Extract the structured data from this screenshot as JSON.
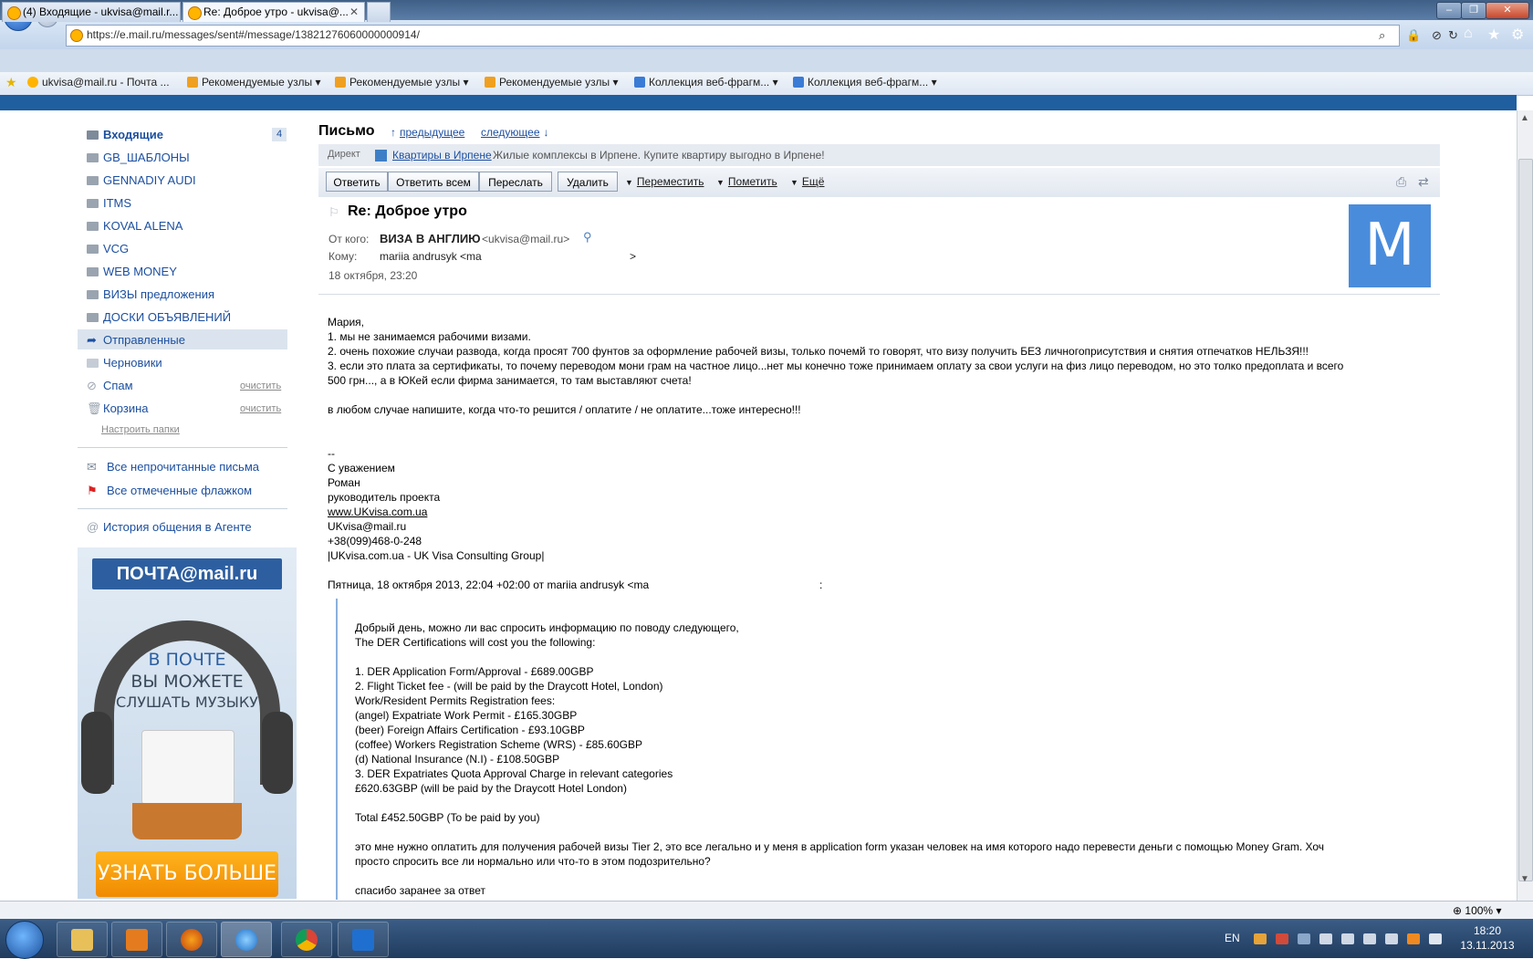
{
  "browser": {
    "url": "https://e.mail.ru/messages/sent#/message/13821276060000000914/",
    "tabs": [
      {
        "label": "(4) Входящие - ukvisa@mail.r..."
      },
      {
        "label": "Re: Доброе утро - ukvisa@..."
      }
    ],
    "favorites": [
      "ukvisa@mail.ru - Почта ...",
      "Рекомендуемые узлы",
      "Рекомендуемые узлы",
      "Рекомендуемые узлы",
      "Коллекция веб-фрагм...",
      "Коллекция веб-фрагм..."
    ],
    "zoom": "100%"
  },
  "sidebar": {
    "inbox": {
      "label": "Входящие",
      "count": "4"
    },
    "folders": [
      "GB_ШАБЛОНЫ",
      "GENNADIY AUDI",
      "ITMS",
      "KOVAL ALENA",
      "VCG",
      "WEB MONEY",
      "ВИЗЫ предложения",
      "ДОСКИ ОБЪЯВЛЕНИЙ"
    ],
    "sent": "Отправленные",
    "drafts": "Черновики",
    "spam": {
      "label": "Спам",
      "action": "очистить"
    },
    "trash": {
      "label": "Корзина",
      "action": "очистить"
    },
    "configure": "Настроить папки",
    "unread": "Все непрочитанные письма",
    "flagged": "Все отмеченные флажком",
    "agent": "История общения в Агенте",
    "ad": {
      "logo": "ПОЧТА@mail.ru",
      "line1": "В ПОЧТЕ",
      "line2": "ВЫ МОЖЕТЕ",
      "line3": "СЛУШАТЬ МУЗЫКУ",
      "button": "УЗНАТЬ БОЛЬШЕ"
    }
  },
  "message": {
    "section": "Письмо",
    "prev": "предыдущее",
    "next": "следующее",
    "direct": {
      "label": "Директ",
      "link": "Квартиры в Ирпене",
      "text": "Жилые комплексы в Ирпене. Купите квартиру выгодно в Ирпене!"
    },
    "actions": {
      "reply": "Ответить",
      "reply_all": "Ответить всем",
      "forward": "Переслать",
      "delete": "Удалить",
      "move": "Переместить",
      "mark": "Пометить",
      "more": "Ещё"
    },
    "subject": "Re: Доброе утро",
    "from_label": "От кого:",
    "from_name": "ВИЗА В АНГЛИЮ",
    "from_email": "<ukvisa@mail.ru>",
    "to_label": "Кому:",
    "to_value": "mariia andrusyk <ma",
    "to_end": ">",
    "date": "18 октября, 23:20",
    "avatar_letter": "M",
    "body": [
      "Мария,",
      "1. мы не занимаемся рабочими визами.",
      "2. очень похожие случаи развода, когда просят 700 фунтов за оформление рабочей визы, только почемй то говорят, что визу получить БЕЗ личногоприсутствия и снятия отпечатков НЕЛЬЗЯ!!!",
      "3. если это плата за сертификаты, то почему переводом мони грам на частное лицо...нет мы конечно тоже принимаем оплату за свои услуги на физ лицо переводом, но это толко предоплата и всего",
      "500 грн..., а в ЮКей если фирма занимается, то там выставляют счета!",
      "в любом случае напишите, когда что-то решится / оплатите / не оплатите...тоже интересно!!!"
    ],
    "signature": [
      "--",
      "С уважением",
      "Роман",
      "руководитель проекта",
      "www.UKvisa.com.ua",
      "UKvisa@mail.ru",
      "+38(099)468-0-248",
      "|UKvisa.com.ua - UK Visa Consulting Group|"
    ],
    "quote_header": "Пятница, 18 октября 2013, 22:04 +02:00 от mariia andrusyk <ma",
    "quote_header_end": ":",
    "quote": [
      "Добрый день, можно ли вас спросить информацию по поводу следующего,",
      "The DER Certifications will cost you the following:",
      "1. DER Application Form/Approval - £689.00GBP",
      "2. Flight Ticket fee - (will be paid by the Draycott Hotel, London)",
      "Work/Resident Permits Registration fees:",
      "(angel) Expatriate Work Permit - £165.30GBP",
      "(beer) Foreign Affairs Certification - £93.10GBP",
      "(coffee) Workers Registration Scheme (WRS) - £85.60GBP",
      "(d) National Insurance (N.I) - £108.50GBP",
      "3. DER Expatriates Quota Approval Charge in relevant categories",
      "£620.63GBP (will be paid by the Draycott Hotel London)",
      "Total £452.50GBP (To be paid by you)",
      "это мне нужно оплатить для получения рабочей визы Tier 2, это все легально и у меня в application form указан человек на имя которого надо перевести деньги с помощью Money Gram. Хоч",
      "просто спросить все ли нормально или что-то в этом подозрительно?",
      "спасибо заранее за ответ"
    ]
  },
  "taskbar": {
    "lang": "EN",
    "time": "18:20",
    "date": "13.11.2013"
  },
  "colors": {
    "accent": "#1c4fa0",
    "avatar": "#4a8cdc",
    "ad_button": "#f08a00"
  }
}
